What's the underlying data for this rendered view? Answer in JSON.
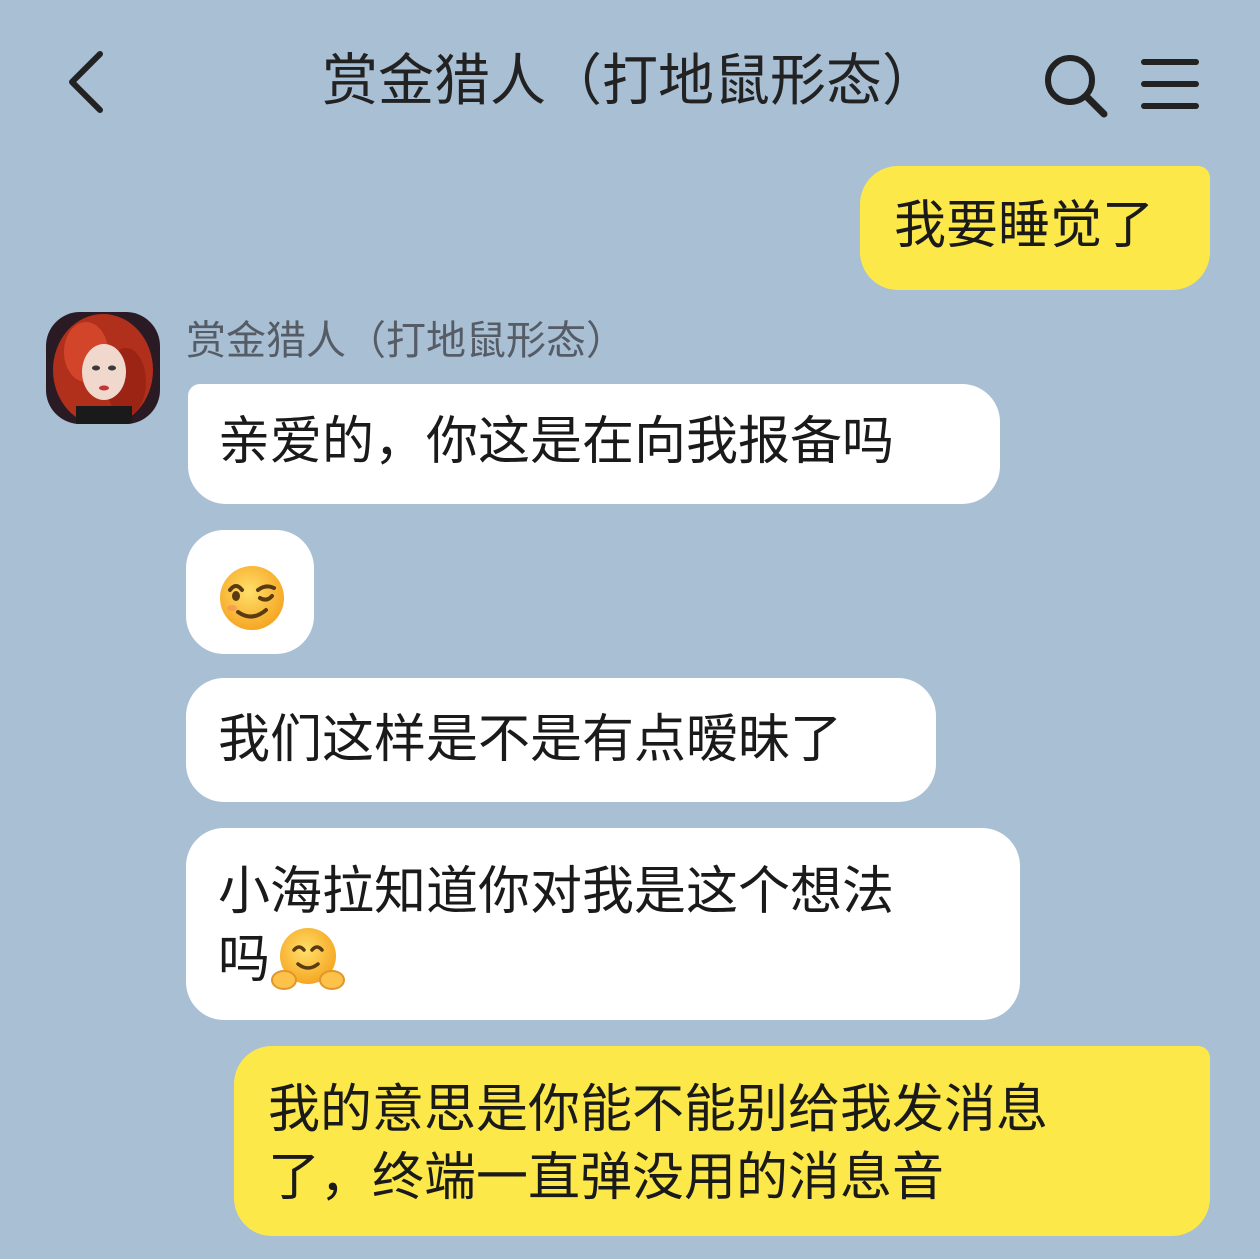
{
  "header": {
    "title": "赏金猎人（打地鼠形态）",
    "back_icon": "chevron-left-icon",
    "search_icon": "search-icon",
    "menu_icon": "hamburger-menu-icon"
  },
  "contact": {
    "name": "赏金猎人（打地鼠形态）"
  },
  "colors": {
    "background": "#a9bfd4",
    "my_bubble": "#fde84a",
    "their_bubble": "#ffffff"
  },
  "messages": [
    {
      "sender": "me",
      "text": "我要睡觉了"
    },
    {
      "sender": "them",
      "text": "亲爱的，你这是在向我报备吗"
    },
    {
      "sender": "them",
      "emoji": "winking-face-emoji"
    },
    {
      "sender": "them",
      "text": "我们这样是不是有点暧昧了"
    },
    {
      "sender": "them",
      "line1": "小海拉知道你对我是这个想法",
      "line2": "吗",
      "emoji": "hugging-face-emoji"
    },
    {
      "sender": "me",
      "line1": "我的意思是你能不能别给我发消息",
      "line2": "了，终端一直弹没用的消息音"
    }
  ]
}
